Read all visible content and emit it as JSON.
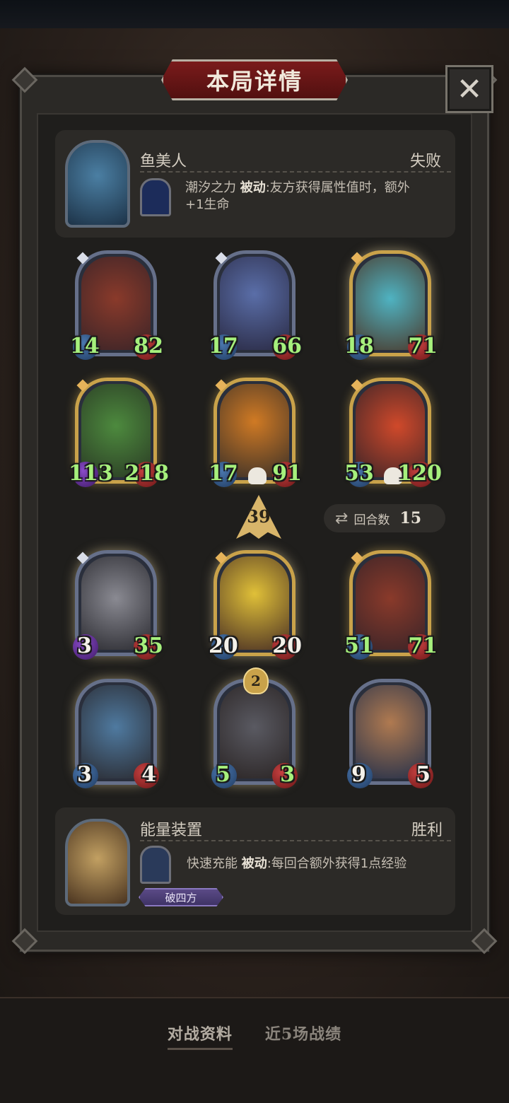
{
  "header": {
    "title": "本局详情",
    "close_icon": "close-icon"
  },
  "opponent": {
    "name": "鱼美人",
    "result": "失败",
    "skill_name": "潮汐之力",
    "skill_type": "被动",
    "skill_desc_line1": ":友方获得属性值时，额外",
    "skill_desc_line2": "+1生命",
    "cards_row1": [
      {
        "atk": "14",
        "hp": "82",
        "frame": "silver"
      },
      {
        "atk": "17",
        "hp": "66",
        "frame": "silver"
      },
      {
        "atk": "18",
        "hp": "71",
        "frame": "gold"
      }
    ],
    "cards_row2": [
      {
        "atk": "113",
        "hp": "218",
        "frame": "gold"
      },
      {
        "atk": "17",
        "hp": "91",
        "frame": "gold"
      },
      {
        "atk": "53",
        "hp": "120",
        "frame": "gold"
      }
    ]
  },
  "middle": {
    "level": "39",
    "round_label": "回合数",
    "round_value": "15"
  },
  "player": {
    "cards_row1": [
      {
        "atk": "3",
        "hp": "35",
        "frame": "silver"
      },
      {
        "atk": "20",
        "hp": "20",
        "frame": "gold"
      },
      {
        "atk": "51",
        "hp": "71",
        "frame": "gold"
      }
    ],
    "cards_row2": [
      {
        "atk": "3",
        "hp": "4",
        "frame": "silver"
      },
      {
        "atk": "5",
        "hp": "3",
        "frame": "silver",
        "tier": "2"
      },
      {
        "atk": "9",
        "hp": "5",
        "frame": "silver"
      }
    ],
    "name": "能量装置",
    "result": "胜利",
    "skill_name": "快速充能",
    "skill_type": "被动",
    "skill_desc": ":每回合额外获得1点经验",
    "tag": "破四方"
  },
  "bottom_tabs": [
    "对战资料",
    "近5场战绩"
  ]
}
